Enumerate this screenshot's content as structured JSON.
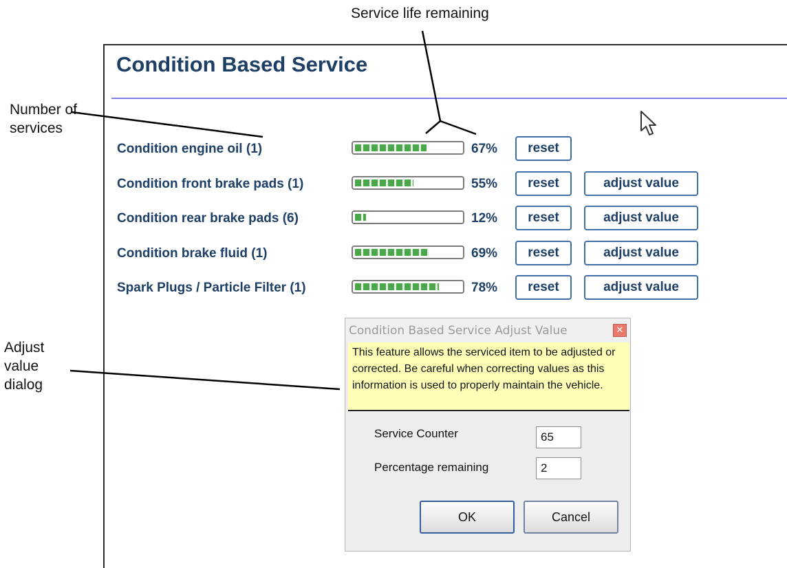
{
  "annotations": {
    "service_life": "Service life remaining",
    "number_of_services": [
      "Number of",
      "services"
    ],
    "adjust_dialog": [
      "Adjust",
      "value",
      "dialog"
    ]
  },
  "window": {
    "title": "Condition Based Service",
    "rows": [
      {
        "label": "Condition engine oil (1)",
        "percent": 67,
        "percent_text": "67%",
        "reset_label": "reset",
        "adjust_label": null
      },
      {
        "label": "Condition front brake pads (1)",
        "percent": 55,
        "percent_text": "55%",
        "reset_label": "reset",
        "adjust_label": "adjust value"
      },
      {
        "label": "Condition rear brake pads (6)",
        "percent": 12,
        "percent_text": "12%",
        "reset_label": "reset",
        "adjust_label": "adjust value"
      },
      {
        "label": "Condition brake fluid (1)",
        "percent": 69,
        "percent_text": "69%",
        "reset_label": "reset",
        "adjust_label": "adjust value"
      },
      {
        "label": "Spark Plugs / Particle Filter (1)",
        "percent": 78,
        "percent_text": "78%",
        "reset_label": "reset",
        "adjust_label": "adjust value"
      }
    ],
    "bar_color": "#4aa84a",
    "title_color": "#1d3f66"
  },
  "dialog": {
    "title": "Condition Based Service Adjust Value",
    "close_icon": "close-icon",
    "notice": "This feature allows the serviced item to be adjusted or corrected. Be careful when correcting values as this information is used to properly maintain the vehicle.",
    "service_counter_label": "Service Counter",
    "service_counter_value": "65",
    "percentage_label": "Percentage remaining",
    "percentage_value": "2",
    "ok_label": "OK",
    "cancel_label": "Cancel"
  }
}
